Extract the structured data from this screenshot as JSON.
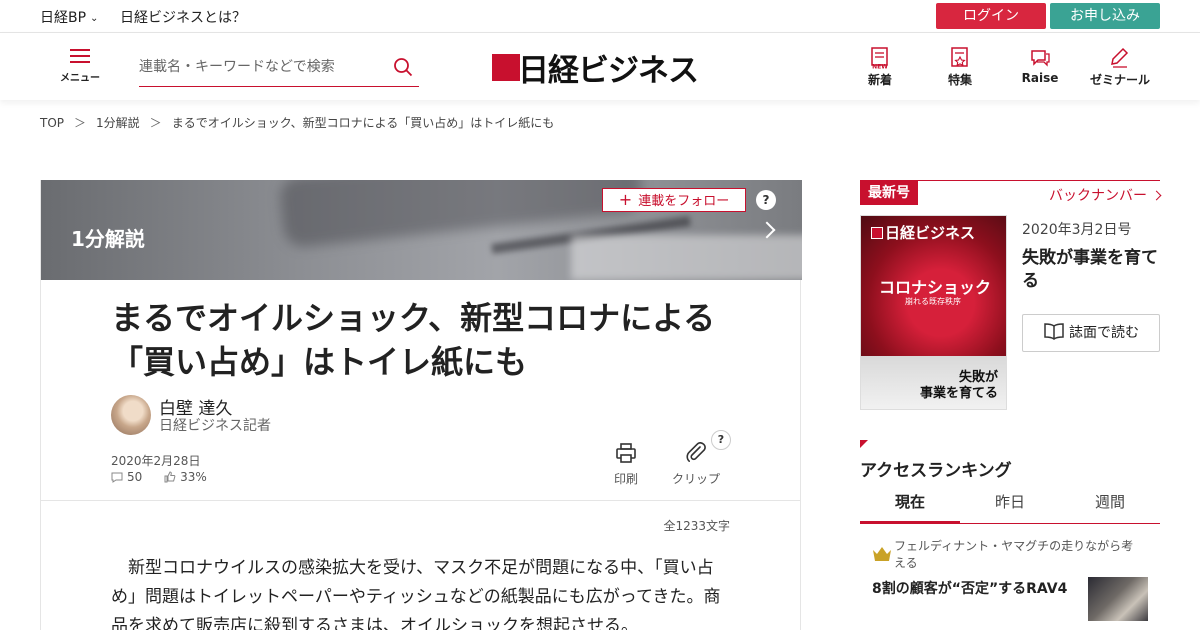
{
  "topbar": {
    "bp_label": "日経BP",
    "about_label": "日経ビジネスとは？",
    "login_label": "ログイン",
    "apply_label": "お申し込み"
  },
  "header": {
    "menu_label": "メニュー",
    "search_placeholder": "連載名・キーワードなどで検索",
    "logo_text": "日経ビジネス",
    "nav": [
      {
        "label": "新着",
        "icon": "new-icon"
      },
      {
        "label": "特集",
        "icon": "feature-icon"
      },
      {
        "label": "Raise",
        "icon": "raise-icon"
      },
      {
        "label": "ゼミナール",
        "icon": "pen-icon"
      }
    ]
  },
  "breadcrumb": {
    "items": [
      "TOP",
      "1分解説",
      "まるでオイルショック、新型コロナによる「買い占め」はトイレ紙にも"
    ],
    "separator": "＞"
  },
  "series": {
    "name": "1分解説",
    "follow_label": "連載をフォロー",
    "help_label": "?"
  },
  "article": {
    "title": "まるでオイルショック、新型コロナによる「買い占め」はトイレ紙にも",
    "author_name": "白壁 達久",
    "author_role": "日経ビジネス記者",
    "date": "2020年2月28日",
    "comments": "50",
    "likes": "33%",
    "print_label": "印刷",
    "clip_label": "クリップ",
    "clip_help": "?",
    "char_count": "全1233文字",
    "body": "　新型コロナウイルスの感染拡大を受け、マスク不足が問題になる中、「買い占め」問題はトイレットペーパーやティッシュなどの紙製品にも広がってきた。商品を求めて販売店に殺到するさまは、オイルショックを想起させる。"
  },
  "sidebar": {
    "latest_badge": "最新号",
    "back_numbers": "バックナンバー",
    "cover": {
      "mag_title": "日経ビジネス",
      "headline": "コロナショック",
      "subhead": "崩れる既存秩序",
      "feature_line1": "失敗が",
      "feature_line2": "事業を育てる"
    },
    "issue_date": "2020年3月2日号",
    "issue_title": "失敗が事業を育てる",
    "read_label": "誌面で読む",
    "ranking_title": "アクセスランキング",
    "ranking_tabs": [
      "現在",
      "昨日",
      "週間"
    ],
    "ranking_kicker": "フェルディナント・ヤマグチの走りながら考える",
    "ranking_headline": "8割の顧客が“否定”するRAV4"
  },
  "colors": {
    "brand_red": "#c8102e",
    "login_red": "#d8263f",
    "apply_teal": "#3aa394"
  }
}
